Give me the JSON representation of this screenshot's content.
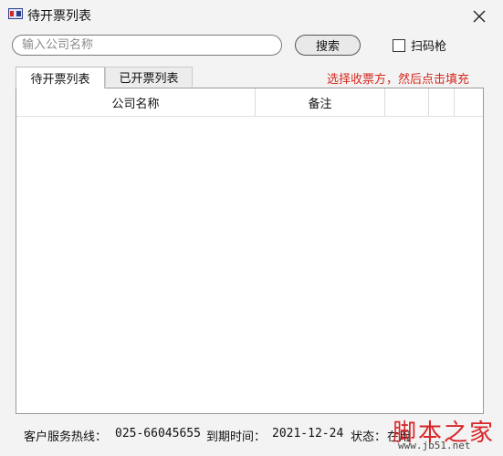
{
  "window": {
    "title": "待开票列表"
  },
  "search": {
    "placeholder": "输入公司名称",
    "value": "",
    "button_label": "搜索"
  },
  "scanner": {
    "label": "扫码枪",
    "checked": false
  },
  "tabs": [
    {
      "label": "待开票列表",
      "active": true
    },
    {
      "label": "已开票列表",
      "active": false
    }
  ],
  "hint": "选择收票方，然后点击填充",
  "table": {
    "columns": [
      "公司名称",
      "备注",
      "",
      "",
      "",
      ""
    ],
    "rows": []
  },
  "status": {
    "hotline_label": "客户服务热线：",
    "hotline_value": "025-66045655",
    "expiry_label": "到期时间：",
    "expiry_value": "2021-12-24",
    "state_label": "状态：",
    "state_value": "在用"
  },
  "watermark": {
    "title": "脚本之家",
    "url": "www.jb51.net"
  },
  "colors": {
    "hint": "#d6281e",
    "watermark": "#d8262a"
  }
}
